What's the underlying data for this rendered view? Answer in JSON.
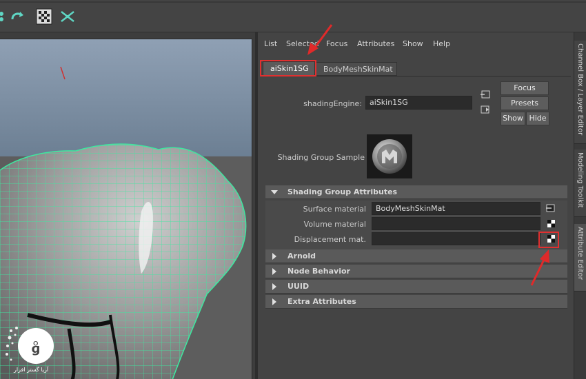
{
  "toolbar": {
    "icons": [
      "snap-icon",
      "redo-icon",
      "checker-icon",
      "mesh-symmetry-icon"
    ]
  },
  "menu": {
    "items": [
      "List",
      "Selected",
      "Focus",
      "Attributes",
      "Show",
      "Help"
    ]
  },
  "tabs": [
    {
      "label": "aiSkin1SG",
      "active": true
    },
    {
      "label": "BodyMeshSkinMat",
      "active": false
    }
  ],
  "node": {
    "type_label": "shadingEngine:",
    "name": "aiSkin1SG"
  },
  "buttons": {
    "focus": "Focus",
    "presets": "Presets",
    "show": "Show",
    "hide": "Hide"
  },
  "sample": {
    "label": "Shading Group Sample"
  },
  "sections": {
    "shading_group": "Shading Group Attributes",
    "arnold": "Arnold",
    "node_behavior": "Node Behavior",
    "uuid": "UUID",
    "extra": "Extra Attributes"
  },
  "attributes": {
    "surface_label": "Surface material",
    "surface_value": "BodyMeshSkinMat",
    "volume_label": "Volume material",
    "volume_value": "",
    "displacement_label": "Displacement mat.",
    "displacement_value": ""
  },
  "side_tabs": [
    {
      "label": "Channel Box / Layer Editor",
      "active": false
    },
    {
      "label": "Modeling Toolkit",
      "active": false
    },
    {
      "label": "Attribute Editor",
      "active": true
    }
  ],
  "watermark": {
    "text": "آریا گستر افزار"
  },
  "colors": {
    "panel_bg": "#444444",
    "field_bg": "#2b2b2b",
    "highlight_red": "#e03030",
    "wireframe": "#3ee8a0"
  }
}
